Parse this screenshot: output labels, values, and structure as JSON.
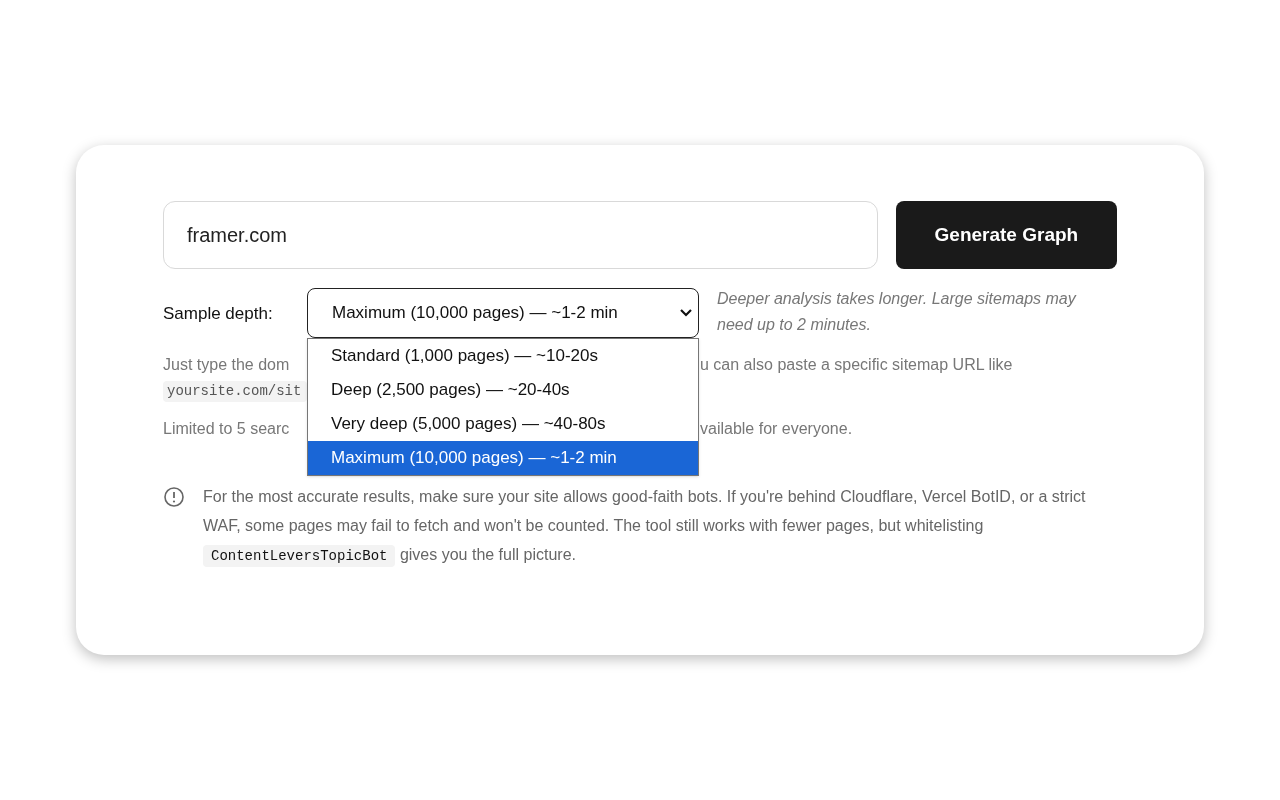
{
  "url_field": {
    "value": "framer.com"
  },
  "generate_button": {
    "label": "Generate Graph"
  },
  "sample_depth": {
    "label": "Sample depth:",
    "value": "Maximum (10,000 pages) — ~1-2 min",
    "expanded": true,
    "options": [
      {
        "label": "Standard (1,000 pages) — ~10-20s",
        "selected": false
      },
      {
        "label": "Deep (2,500 pages) — ~20-40s",
        "selected": false
      },
      {
        "label": "Very deep (5,000 pages) — ~40-80s",
        "selected": false
      },
      {
        "label": "Maximum (10,000 pages) — ~1-2 min",
        "selected": true
      }
    ]
  },
  "hint": "Deeper analysis takes longer. Large sitemaps may need up to 2 minutes.",
  "help_lines": [
    {
      "left": "Just type the dom",
      "right": "u can also paste a specific sitemap URL like",
      "kind": "text"
    },
    {
      "left": "yoursite.com/sit",
      "kind": "code"
    },
    {
      "left": "Limited to 5 searc",
      "right": "vailable for everyone.",
      "kind": "text"
    }
  ],
  "notice": {
    "before": "For the most accurate results, make sure your site allows good-faith bots. If you're behind Cloudflare, Vercel BotID, or a strict WAF, some pages may fail to fetch and won't be counted. The tool still works with fewer pages, but whitelisting",
    "code": "ContentLeversTopicBot",
    "after": "gives you the full picture."
  }
}
